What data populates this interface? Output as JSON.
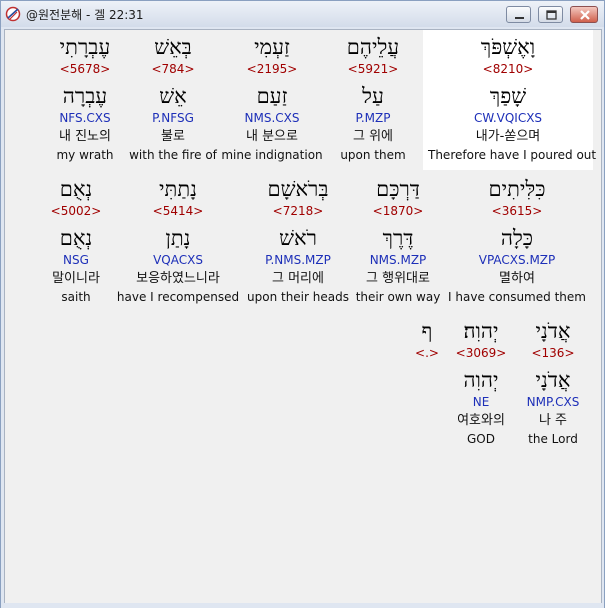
{
  "window": {
    "title": "@원전분해 - 겔 22:31",
    "buttons": {
      "minimize": "minimize-icon",
      "maximize": "maximize-icon",
      "close": "close-icon"
    }
  },
  "rows": [
    {
      "words": [
        {
          "hebrew": "וָאֶשְׁפֹּךְ",
          "strong": "<8210>",
          "lemma": "שָׁפַךְ",
          "morph": "CW.VQICXS",
          "korean": "내가-쏟으며",
          "english": "Therefore have I poured out"
        },
        {
          "hebrew": "עֲלֵיהֶם",
          "strong": "<5921>",
          "lemma": "עַל",
          "morph": "P.MZP",
          "korean": "그 위에",
          "english": "upon them"
        },
        {
          "hebrew": "זַעְמִי",
          "strong": "<2195>",
          "lemma": "זַעַם",
          "morph": "NMS.CXS",
          "korean": "내 분으로",
          "english": "mine indignation"
        },
        {
          "hebrew": "בְּאֵשׁ",
          "strong": "<784>",
          "lemma": "אֵשׁ",
          "morph": "P.NFSG",
          "korean": "불로",
          "english": "with the fire of"
        },
        {
          "hebrew": "עֶבְרָתִי",
          "strong": "<5678>",
          "lemma": "עֶבְרָה",
          "morph": "NFS.CXS",
          "korean": "내 진노의",
          "english": "my wrath"
        }
      ]
    },
    {
      "words": [
        {
          "hebrew": "כִּלִּיתִים",
          "strong": "<3615>",
          "lemma": "כָּלָה",
          "morph": "VPACXS.MZP",
          "korean": "멸하여",
          "english": "I have consumed them"
        },
        {
          "hebrew": "דַּרְכָּם",
          "strong": "<1870>",
          "lemma": "דֶּרֶךְ",
          "morph": "NMS.MZP",
          "korean": "그 행위대로",
          "english": "their own way"
        },
        {
          "hebrew": "בְּרֹאשָׁם",
          "strong": "<7218>",
          "lemma": "רֹאשׁ",
          "morph": "P.NMS.MZP",
          "korean": "그 머리에",
          "english": "upon their heads"
        },
        {
          "hebrew": "נָתַתִּי",
          "strong": "<5414>",
          "lemma": "נָתַן",
          "morph": "VQACXS",
          "korean": "보응하였느니라",
          "english": "have I recompensed"
        },
        {
          "hebrew": "נְאֻם",
          "strong": "<5002>",
          "lemma": "נְאֻם",
          "morph": "NSG",
          "korean": "말이니라",
          "english": "saith"
        }
      ]
    },
    {
      "words": [
        {
          "hebrew": "אֲדֹנָי",
          "strong": "<136>",
          "lemma": "אֲדֹנָי",
          "morph": "NMP.CXS",
          "korean": "나 주",
          "english": "the Lord"
        },
        {
          "hebrew": "יְהוִה׃",
          "strong": "<3069>",
          "lemma": "יְהוִה",
          "morph": "NE",
          "korean": "여호와의",
          "english": "GOD"
        },
        {
          "hebrew": "ף",
          "strong": "<.>",
          "lemma": "",
          "morph": "",
          "korean": "",
          "english": ""
        }
      ]
    }
  ]
}
